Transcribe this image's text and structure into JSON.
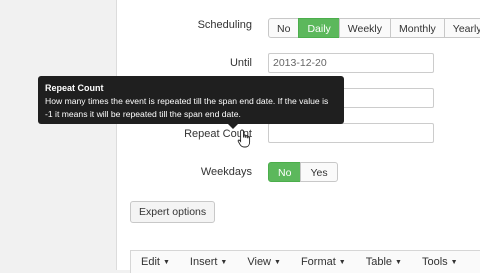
{
  "scheduling": {
    "label": "Scheduling",
    "options": [
      "No",
      "Daily",
      "Weekly",
      "Monthly",
      "Yearly"
    ],
    "selected": "Daily"
  },
  "until": {
    "label": "Until",
    "value": "2013-12-20"
  },
  "repeat_count": {
    "label": "Repeat Count",
    "value": ""
  },
  "weekdays": {
    "label": "Weekdays",
    "options": [
      "No",
      "Yes"
    ],
    "selected": "No"
  },
  "tooltip": {
    "title": "Repeat Count",
    "line1": "How many times the event is repeated till the span end date. If the value is",
    "line2": "-1 it means it will be repeated till the span end date."
  },
  "expert_button": "Expert options",
  "editor_menu": {
    "items": [
      {
        "label": "Edit"
      },
      {
        "label": "Insert"
      },
      {
        "label": "View"
      },
      {
        "label": "Format"
      },
      {
        "label": "Table"
      },
      {
        "label": "Tools"
      }
    ],
    "caret": "▼"
  }
}
